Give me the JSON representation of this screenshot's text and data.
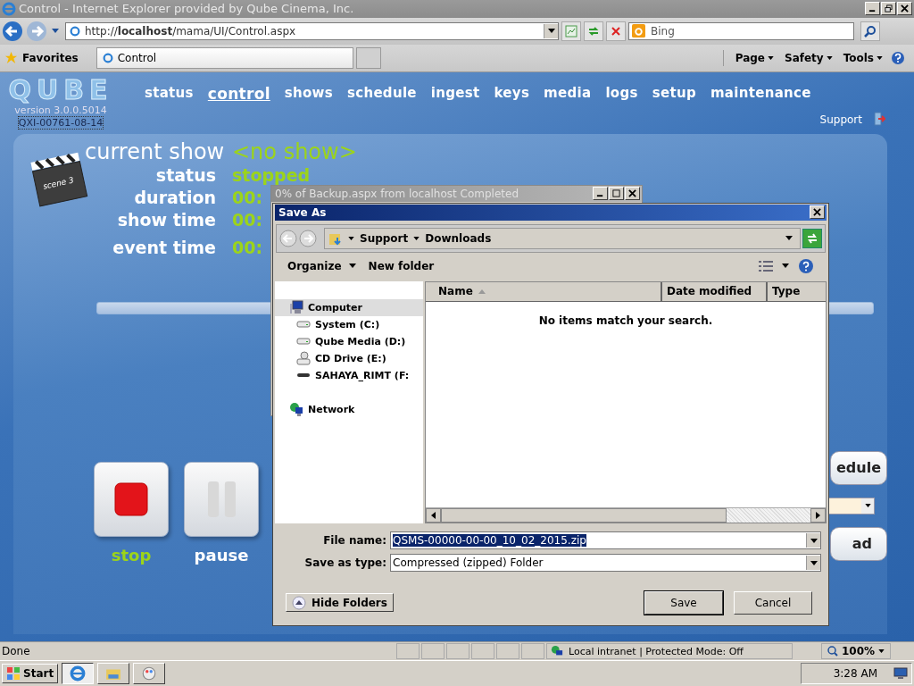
{
  "browser": {
    "title": "Control - Internet Explorer provided by Qube Cinema, Inc.",
    "address": "http://**localhost**/mama/UI/Control.aspx",
    "search_placeholder": "Bing",
    "favorites": "Favorites",
    "tab": "Control",
    "commands": [
      "Page",
      "Safety",
      "Tools"
    ]
  },
  "app": {
    "logo": "QUBE",
    "version": "version 3.0.0.5014",
    "serial": "QXI-00761-08-14",
    "support": "Support",
    "nav": [
      {
        "label": "status",
        "selected": false
      },
      {
        "label": "control",
        "selected": true
      },
      {
        "label": "shows",
        "selected": false
      },
      {
        "label": "schedule",
        "selected": false
      },
      {
        "label": "ingest",
        "selected": false
      },
      {
        "label": "keys",
        "selected": false
      },
      {
        "label": "media",
        "selected": false
      },
      {
        "label": "logs",
        "selected": false
      },
      {
        "label": "setup",
        "selected": false
      },
      {
        "label": "maintenance",
        "selected": false
      }
    ],
    "show": {
      "label": "current show",
      "value": "<no show>",
      "clapper_text": "scene 3",
      "fields": [
        {
          "label": "status",
          "value": "stopped"
        },
        {
          "label": "duration",
          "value": "00:"
        },
        {
          "label": "show time",
          "value": "00:"
        },
        {
          "label": "event time",
          "value": "00:"
        }
      ]
    },
    "controls": [
      {
        "label": "stop",
        "kind": "stop",
        "active": true
      },
      {
        "label": "pause",
        "kind": "pause",
        "active": false
      }
    ],
    "side_buttons": [
      "edule",
      "ad"
    ]
  },
  "download_window": {
    "title": "0% of Backup.aspx from localhost Completed"
  },
  "save_as": {
    "title": "Save As",
    "path": [
      "Support",
      "Downloads"
    ],
    "organize": "Organize",
    "new_folder": "New folder",
    "tree": [
      {
        "label": "Computer",
        "kind": "computer",
        "selected": true,
        "children": [
          {
            "label": "System (C:)",
            "kind": "drive",
            "selected": false
          },
          {
            "label": "Qube Media (D:)",
            "kind": "drive",
            "selected": false
          },
          {
            "label": "CD Drive (E:)",
            "kind": "cd",
            "selected": false
          },
          {
            "label": "SAHAYA_RIMT (F:",
            "kind": "usb",
            "selected": false
          }
        ]
      },
      {
        "label": "Network",
        "kind": "network",
        "selected": false
      }
    ],
    "columns": [
      {
        "label": "Name",
        "sorted": true
      },
      {
        "label": "Date modified",
        "sorted": false
      },
      {
        "label": "Type",
        "sorted": false
      }
    ],
    "empty_message": "No items match your search.",
    "file_name_label": "File name:",
    "file_name": "QSMS-00000-00-00_10_02_2015.zip",
    "type_label": "Save as type:",
    "type": "Compressed (zipped) Folder",
    "hide_folders": "Hide Folders",
    "save": "Save",
    "cancel": "Cancel"
  },
  "status_bar": {
    "text": "Done",
    "zone": "Local intranet | Protected Mode: Off",
    "zoom": "100%"
  },
  "taskbar": {
    "start": "Start",
    "clock": "3:28 AM"
  }
}
